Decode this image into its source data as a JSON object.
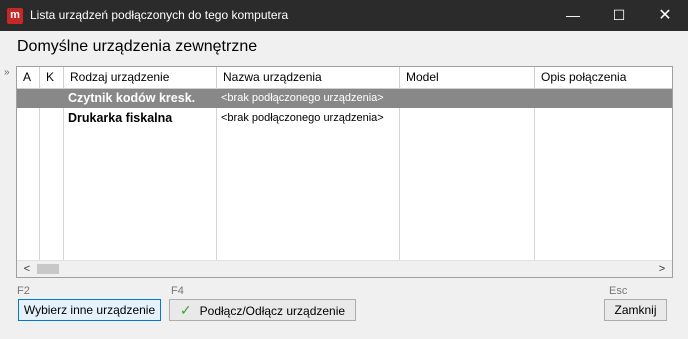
{
  "window": {
    "app_icon_letter": "m",
    "title": "Lista urządzeń podłączonych do tego komputera",
    "minimize": "—",
    "maximize": "☐",
    "close": "✕"
  },
  "section_title": "Domyślne urządzenia zewnętrzne",
  "grid": {
    "row_indicator": "»",
    "columns": [
      "A",
      "K",
      "Rodzaj urządzenie",
      "Nazwa urządzenia",
      "Model",
      "Opis połączenia"
    ],
    "rows": [
      {
        "a": "",
        "k": "",
        "type": "Czytnik kodów kresk.",
        "name": "<brak podłączonego urządzenia>",
        "model": "",
        "connection": "",
        "selected": true
      },
      {
        "a": "",
        "k": "",
        "type": "Drukarka fiskalna",
        "name": "<brak podłączonego urządzenia>",
        "model": "",
        "connection": "",
        "selected": false
      }
    ],
    "scroll_left": "<",
    "scroll_right": ">"
  },
  "footer": {
    "select_key": "F2",
    "select_label": "Wybierz inne urządzenie",
    "connect_key": "F4",
    "connect_label": "Podłącz/Odłącz urządzenie",
    "close_key": "Esc",
    "close_label": "Zamknij"
  }
}
